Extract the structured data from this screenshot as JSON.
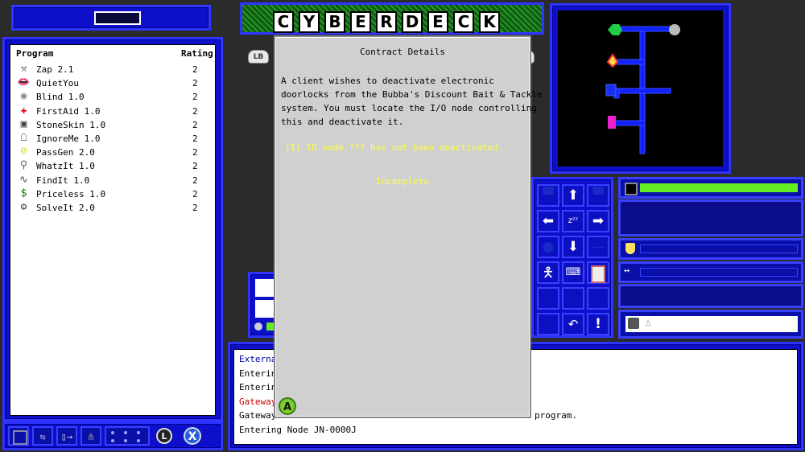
{
  "title_letters": [
    "C",
    "Y",
    "B",
    "E",
    "R",
    "D",
    "E",
    "C",
    "K"
  ],
  "programs": {
    "header_program": "Program",
    "header_rating": "Rating",
    "items": [
      {
        "name": "Zap 2.1",
        "rating": "2",
        "icon": "hammer-icon",
        "glyph": "⚒"
      },
      {
        "name": "QuietYou",
        "rating": "2",
        "icon": "lips-icon",
        "glyph": "👄"
      },
      {
        "name": "Blind 1.0",
        "rating": "2",
        "icon": "mask-icon",
        "glyph": "◉"
      },
      {
        "name": "FirstAid 1.0",
        "rating": "2",
        "icon": "red-cross-icon",
        "glyph": "✚"
      },
      {
        "name": "StoneSkin 1.0",
        "rating": "2",
        "icon": "armor-icon",
        "glyph": "▣"
      },
      {
        "name": "IgnoreMe 1.0",
        "rating": "2",
        "icon": "ghost-figure-icon",
        "glyph": "☖"
      },
      {
        "name": "PassGen 2.0",
        "rating": "2",
        "icon": "smiley-icon",
        "glyph": "☺"
      },
      {
        "name": "WhatzIt 1.0",
        "rating": "2",
        "icon": "magnifier-icon",
        "glyph": "⚲"
      },
      {
        "name": "FindIt 1.0",
        "rating": "2",
        "icon": "wave-icon",
        "glyph": "∿"
      },
      {
        "name": "Priceless 1.0",
        "rating": "2",
        "icon": "dollar-icon",
        "glyph": "$"
      },
      {
        "name": "SolveIt 2.0",
        "rating": "2",
        "icon": "gear-icon",
        "glyph": "⚙"
      }
    ]
  },
  "lb_label": "LB",
  "dialog": {
    "title": "Contract Details",
    "body_lines": [
      "A client wishes to deactivate electronic",
      "doorlocks from the Bubba's Discount Bait & Tackle",
      "system. You must locate the I/O node controlling",
      "this and deactivate it."
    ],
    "objective": "(I) IO node ??? has not been deactivated.",
    "status": "Incomplete",
    "a_button": "A"
  },
  "log": {
    "lines": [
      {
        "text": "Externa",
        "color": "#0000aa"
      },
      {
        "text": "Entering",
        "color": "#000000"
      },
      {
        "text": "Entering",
        "color": "#000000"
      },
      {
        "text": "Gateway",
        "color": "#cc0000"
      },
      {
        "text": "Gateway",
        "color": "#000000"
      },
      {
        "text": "Entering Node JN-0000J",
        "color": "#000000"
      }
    ],
    "right_fragment": "program."
  },
  "bottom_buttons": {
    "l_label": "L",
    "x_label": "X"
  },
  "colors": {
    "panel_blue": "#0d10c8",
    "border_blue": "#2f34ff",
    "health_green": "#66ee22",
    "objective_yellow": "#ffff44"
  },
  "health_fraction": 1.0
}
